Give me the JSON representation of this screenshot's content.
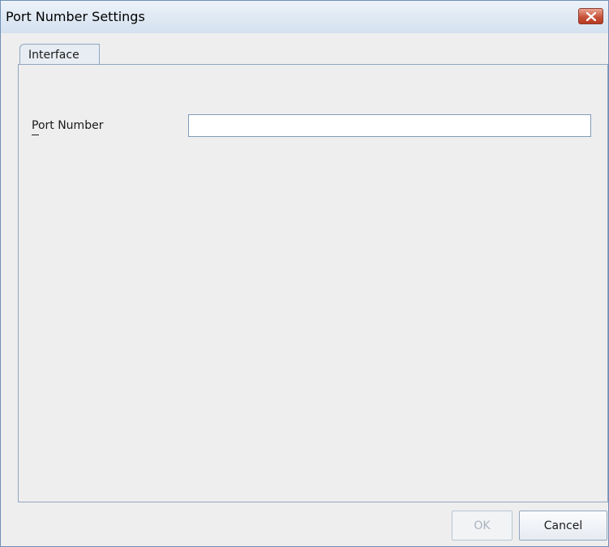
{
  "window": {
    "title": "Port Number Settings"
  },
  "tabs": [
    {
      "label": "Interface",
      "selected": true
    }
  ],
  "form": {
    "port_number_label": "Port Number",
    "port_number_value": ""
  },
  "buttons": {
    "ok_label": "OK",
    "ok_enabled": false,
    "cancel_label": "Cancel"
  },
  "icons": {
    "close": "close-icon"
  }
}
